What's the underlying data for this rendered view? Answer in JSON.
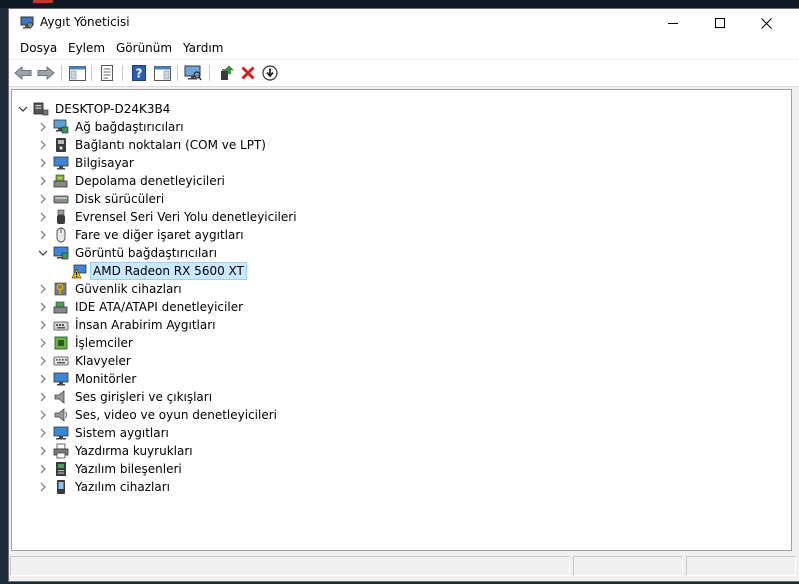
{
  "window": {
    "title": "Aygıt Yöneticisi",
    "app_icon": "device-manager-icon",
    "controls": {
      "minimize": "minimize-icon",
      "maximize": "maximize-icon",
      "close": "close-icon"
    }
  },
  "menu": {
    "items": [
      {
        "label": "Dosya"
      },
      {
        "label": "Eylem"
      },
      {
        "label": "Görünüm"
      },
      {
        "label": "Yardım"
      }
    ]
  },
  "toolbar": {
    "buttons": [
      {
        "icon": "back-arrow-icon"
      },
      {
        "icon": "forward-arrow-icon"
      },
      {
        "icon": "show-hide-console-tree-icon"
      },
      {
        "icon": "properties-icon"
      },
      {
        "icon": "help-icon"
      },
      {
        "icon": "action-pane-icon"
      },
      {
        "icon": "scan-hardware-changes-icon"
      },
      {
        "icon": "update-driver-icon"
      },
      {
        "icon": "uninstall-device-icon"
      },
      {
        "icon": "download-icon"
      }
    ]
  },
  "tree": {
    "root": {
      "label": "DESKTOP-D24K3B4",
      "icon": "computer-icon",
      "expanded": true
    },
    "categories": [
      {
        "label": "Ağ bağdaştırıcıları",
        "icon": "network-adapter-icon",
        "expanded": false
      },
      {
        "label": "Bağlantı noktaları (COM ve LPT)",
        "icon": "port-icon",
        "expanded": false
      },
      {
        "label": "Bilgisayar",
        "icon": "computer-monitor-icon",
        "expanded": false
      },
      {
        "label": "Depolama denetleyicileri",
        "icon": "storage-controller-icon",
        "expanded": false
      },
      {
        "label": "Disk sürücüleri",
        "icon": "disk-drive-icon",
        "expanded": false
      },
      {
        "label": "Evrensel Seri Veri Yolu denetleyicileri",
        "icon": "usb-icon",
        "expanded": false
      },
      {
        "label": "Fare ve diğer işaret aygıtları",
        "icon": "mouse-icon",
        "expanded": false
      },
      {
        "label": "Görüntü bağdaştırıcıları",
        "icon": "display-adapter-icon",
        "expanded": true,
        "children": [
          {
            "label": "AMD Radeon RX 5600 XT",
            "icon": "warning-display-adapter-icon",
            "selected": true
          }
        ]
      },
      {
        "label": "Güvenlik cihazları",
        "icon": "security-device-icon",
        "expanded": false
      },
      {
        "label": "IDE ATA/ATAPI denetleyiciler",
        "icon": "ide-controller-icon",
        "expanded": false
      },
      {
        "label": "İnsan Arabirim Aygıtları",
        "icon": "hid-icon",
        "expanded": false
      },
      {
        "label": "İşlemciler",
        "icon": "processor-icon",
        "expanded": false
      },
      {
        "label": "Klavyeler",
        "icon": "keyboard-icon",
        "expanded": false
      },
      {
        "label": "Monitörler",
        "icon": "monitor-icon",
        "expanded": false
      },
      {
        "label": "Ses girişleri ve çıkışları",
        "icon": "speaker-icon",
        "expanded": false
      },
      {
        "label": "Ses, video ve oyun denetleyicileri",
        "icon": "sound-controller-icon",
        "expanded": false
      },
      {
        "label": "Sistem aygıtları",
        "icon": "system-device-icon",
        "expanded": false
      },
      {
        "label": "Yazdırma kuyrukları",
        "icon": "printer-icon",
        "expanded": false
      },
      {
        "label": "Yazılım bileşenleri",
        "icon": "software-component-icon",
        "expanded": false
      },
      {
        "label": "Yazılım cihazları",
        "icon": "software-device-icon",
        "expanded": false
      }
    ]
  }
}
